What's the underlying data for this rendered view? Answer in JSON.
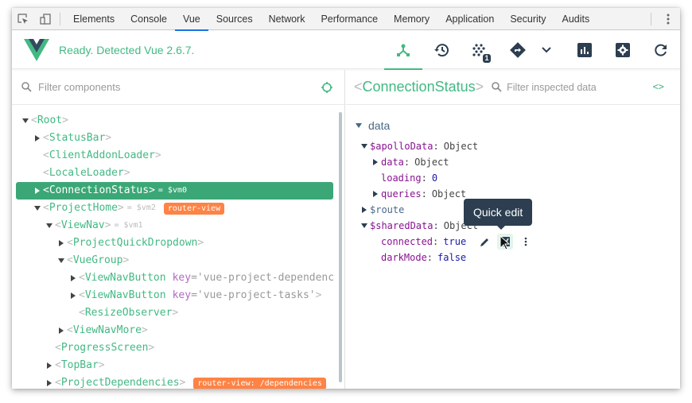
{
  "devtools": {
    "tabs": [
      {
        "label": "Elements",
        "active": false
      },
      {
        "label": "Console",
        "active": false
      },
      {
        "label": "Vue",
        "active": true
      },
      {
        "label": "Sources",
        "active": false
      },
      {
        "label": "Network",
        "active": false
      },
      {
        "label": "Performance",
        "active": false
      },
      {
        "label": "Memory",
        "active": false
      },
      {
        "label": "Application",
        "active": false
      },
      {
        "label": "Security",
        "active": false
      },
      {
        "label": "Audits",
        "active": false
      }
    ],
    "icons": [
      "inspect-element-icon",
      "device-toolbar-icon",
      "more-vert-icon"
    ]
  },
  "vue_header": {
    "status": "Ready. Detected Vue 2.6.7.",
    "toolbar": [
      {
        "name": "components",
        "icon": "component-tree-icon",
        "active": true
      },
      {
        "name": "vuex",
        "icon": "history-icon",
        "active": false
      },
      {
        "name": "events",
        "icon": "events-icon",
        "badge": "1",
        "active": false
      },
      {
        "name": "routing",
        "icon": "routing-icon",
        "active": false
      },
      {
        "name": "routing-dropdown",
        "icon": "chevron-down-icon",
        "active": false
      },
      {
        "name": "performance",
        "icon": "chart-icon",
        "active": false
      },
      {
        "name": "settings",
        "icon": "settings-icon",
        "active": false
      },
      {
        "name": "refresh",
        "icon": "refresh-icon",
        "active": false
      }
    ],
    "colors": {
      "accent": "#42b983",
      "dark": "#2c3e50"
    }
  },
  "components_pane": {
    "filter_placeholder": "Filter components",
    "tree": [
      {
        "depth": 0,
        "arrow": "down",
        "name": "Root"
      },
      {
        "depth": 1,
        "arrow": "right",
        "name": "StatusBar"
      },
      {
        "depth": 1,
        "arrow": "none",
        "name": "ClientAddonLoader"
      },
      {
        "depth": 1,
        "arrow": "none",
        "name": "LocaleLoader"
      },
      {
        "depth": 1,
        "arrow": "right",
        "name": "ConnectionStatus",
        "vm": "= $vm0",
        "selected": true
      },
      {
        "depth": 1,
        "arrow": "down",
        "name": "ProjectHome",
        "vm": "= $vm2",
        "badge": "router-view"
      },
      {
        "depth": 2,
        "arrow": "down",
        "name": "ViewNav",
        "vm": "= $vm1"
      },
      {
        "depth": 3,
        "arrow": "right",
        "name": "ProjectQuickDropdown"
      },
      {
        "depth": 3,
        "arrow": "down",
        "name": "VueGroup"
      },
      {
        "depth": 4,
        "arrow": "right",
        "name": "ViewNavButton",
        "attr_key": "key",
        "attr_val": "='vue-project-dependenc",
        "truncated": true
      },
      {
        "depth": 4,
        "arrow": "right",
        "name": "ViewNavButton",
        "attr_key": "key",
        "attr_val": "='vue-project-tasks'"
      },
      {
        "depth": 4,
        "arrow": "none",
        "name": "ResizeObserver"
      },
      {
        "depth": 3,
        "arrow": "right",
        "name": "ViewNavMore"
      },
      {
        "depth": 2,
        "arrow": "none",
        "name": "ProgressScreen"
      },
      {
        "depth": 2,
        "arrow": "right",
        "name": "TopBar"
      },
      {
        "depth": 2,
        "arrow": "right",
        "name": "ProjectDependencies",
        "badge": "router-view: /dependencies"
      }
    ],
    "badge_color": "#ff8344"
  },
  "inspector": {
    "component_name": "ConnectionStatus",
    "filter_placeholder": "Filter inspected data",
    "section": "data",
    "rows": [
      {
        "depth": 0,
        "arrow": "down",
        "key": "$apolloData",
        "value": "Object",
        "vtype": "obj"
      },
      {
        "depth": 1,
        "arrow": "right",
        "key": "data",
        "value": "Object",
        "vtype": "obj"
      },
      {
        "depth": 1,
        "arrow": "none",
        "key": "loading",
        "value": "0",
        "vtype": "num"
      },
      {
        "depth": 1,
        "arrow": "right",
        "key": "queries",
        "value": "Object",
        "vtype": "obj"
      },
      {
        "depth": 0,
        "arrow": "right",
        "key": "$route",
        "value": "",
        "vtype": "route"
      },
      {
        "depth": 0,
        "arrow": "down",
        "key": "$sharedData",
        "value": "Object",
        "vtype": "obj"
      },
      {
        "depth": 1,
        "arrow": "none",
        "key": "connected",
        "value": "true",
        "vtype": "bool",
        "actions": true
      },
      {
        "depth": 1,
        "arrow": "none",
        "key": "darkMode",
        "value": "false",
        "vtype": "bool"
      }
    ],
    "row_actions": [
      "edit-icon",
      "quick-edit-toggle-icon",
      "more-vert-icon"
    ]
  },
  "tooltip": {
    "text": "Quick edit"
  }
}
